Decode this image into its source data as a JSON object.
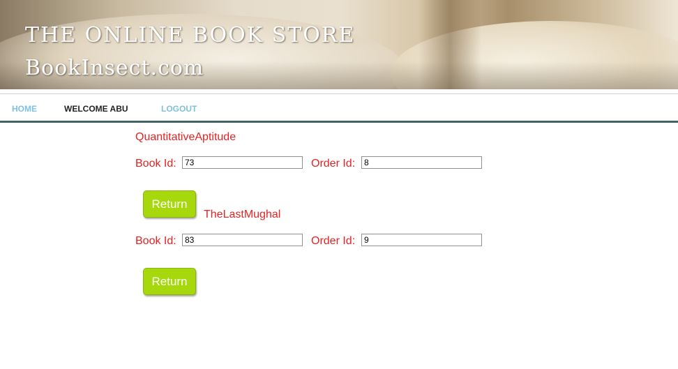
{
  "header": {
    "title": "THE ONLINE BOOK STORE",
    "site": "BookInsect.com"
  },
  "nav": {
    "home": "HOME",
    "welcome": "WELCOME  ABU",
    "logout": "LOGOUT"
  },
  "orders": [
    {
      "book_name": "QuantitativeAptitude",
      "book_id_label": "Book Id:",
      "book_id": "73",
      "order_id_label": "Order Id:",
      "order_id": "8",
      "button": "Return"
    },
    {
      "book_name": "TheLastMughal",
      "book_id_label": "Book Id:",
      "book_id": "83",
      "order_id_label": "Order Id:",
      "order_id": "9",
      "button": "Return"
    }
  ],
  "colors": {
    "text_red": "#e52222",
    "nav_link": "#7fc0dc",
    "nav_bar": "#3f6464",
    "button_green": "#a6d80b"
  }
}
